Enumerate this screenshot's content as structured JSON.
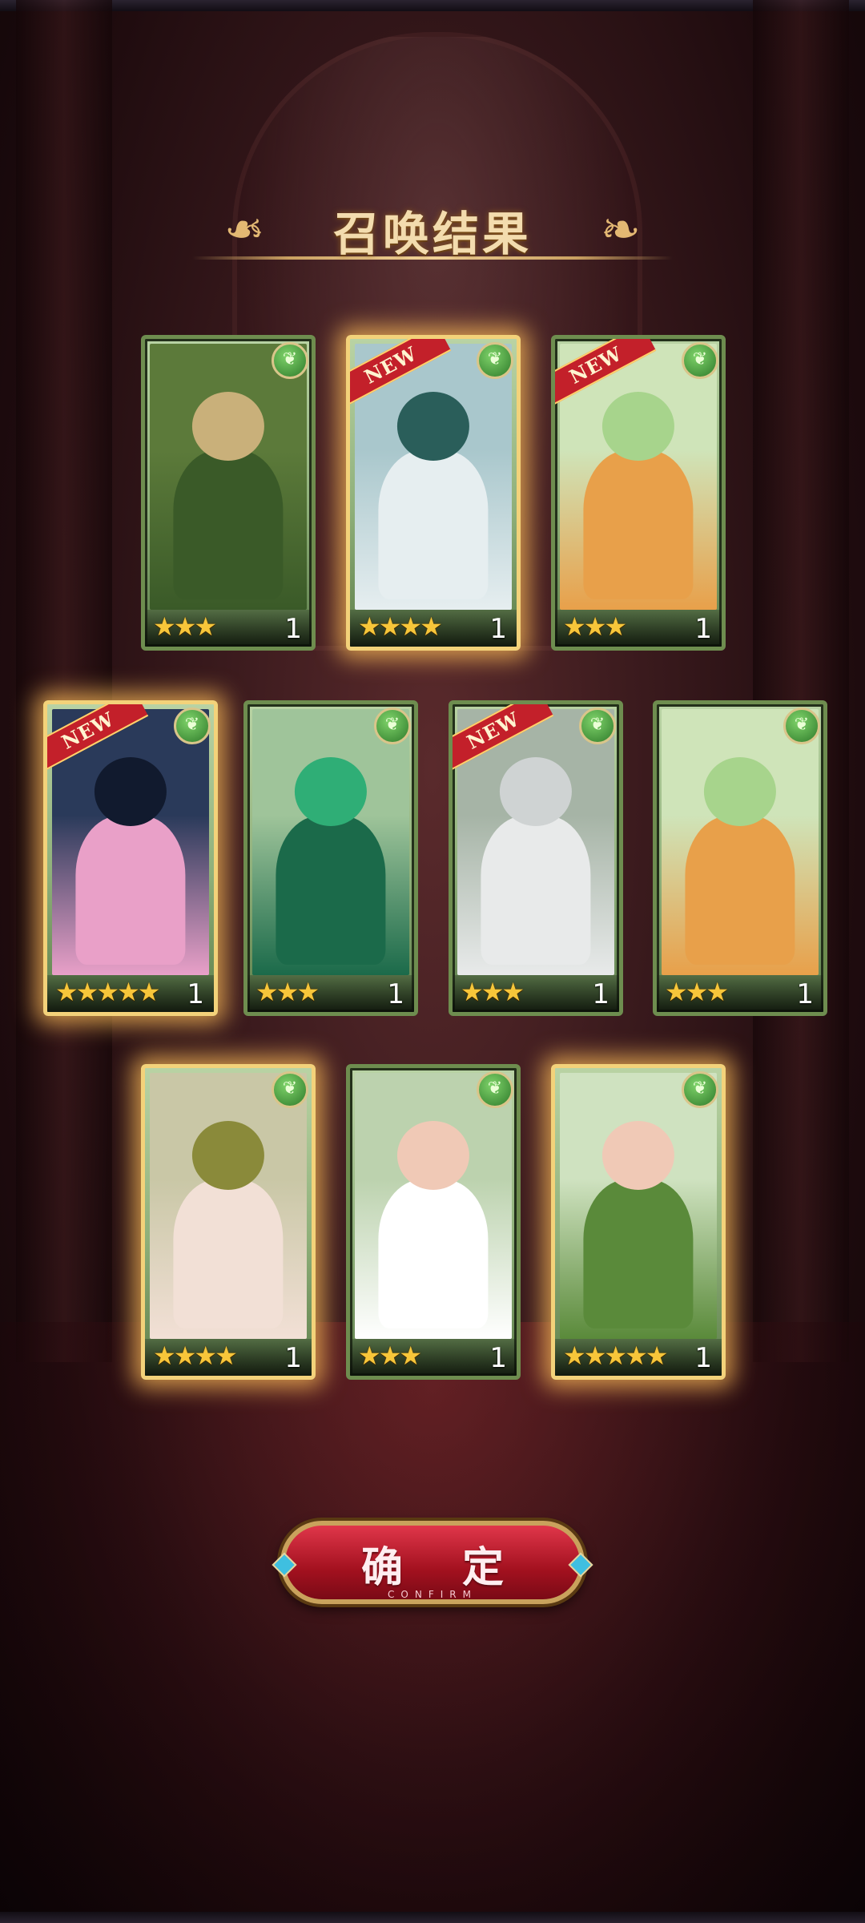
{
  "title": "召唤结果",
  "confirm": {
    "label": "确 定",
    "sub": "CONFIRM"
  },
  "new_badge": "NEW",
  "element_icon": "leaf-icon",
  "colors": {
    "accent_gold": "#f3d27a",
    "confirm_red": "#c3202a",
    "card_green": "#6e8d4f"
  },
  "cards": [
    {
      "stars": "★★★",
      "count": "1",
      "new": false,
      "glow": false,
      "theme": "warrior-green"
    },
    {
      "stars": "★★★★",
      "count": "1",
      "new": true,
      "glow": true,
      "theme": "kimono-teal"
    },
    {
      "stars": "★★★",
      "count": "1",
      "new": true,
      "glow": false,
      "theme": "dancer-green"
    },
    {
      "stars": "★★★★★",
      "count": "1",
      "new": true,
      "glow": true,
      "theme": "mermaid-blue"
    },
    {
      "stars": "★★★",
      "count": "1",
      "new": false,
      "glow": false,
      "theme": "armor-emerald"
    },
    {
      "stars": "★★★",
      "count": "1",
      "new": true,
      "glow": false,
      "theme": "swordsman-white"
    },
    {
      "stars": "★★★",
      "count": "1",
      "new": false,
      "glow": false,
      "theme": "dancer-green"
    },
    {
      "stars": "★★★★",
      "count": "1",
      "new": false,
      "glow": true,
      "theme": "dryad-olive"
    },
    {
      "stars": "★★★",
      "count": "1",
      "new": false,
      "glow": false,
      "theme": "maid-pink"
    },
    {
      "stars": "★★★★★",
      "count": "1",
      "new": false,
      "glow": true,
      "theme": "maid-green"
    }
  ]
}
